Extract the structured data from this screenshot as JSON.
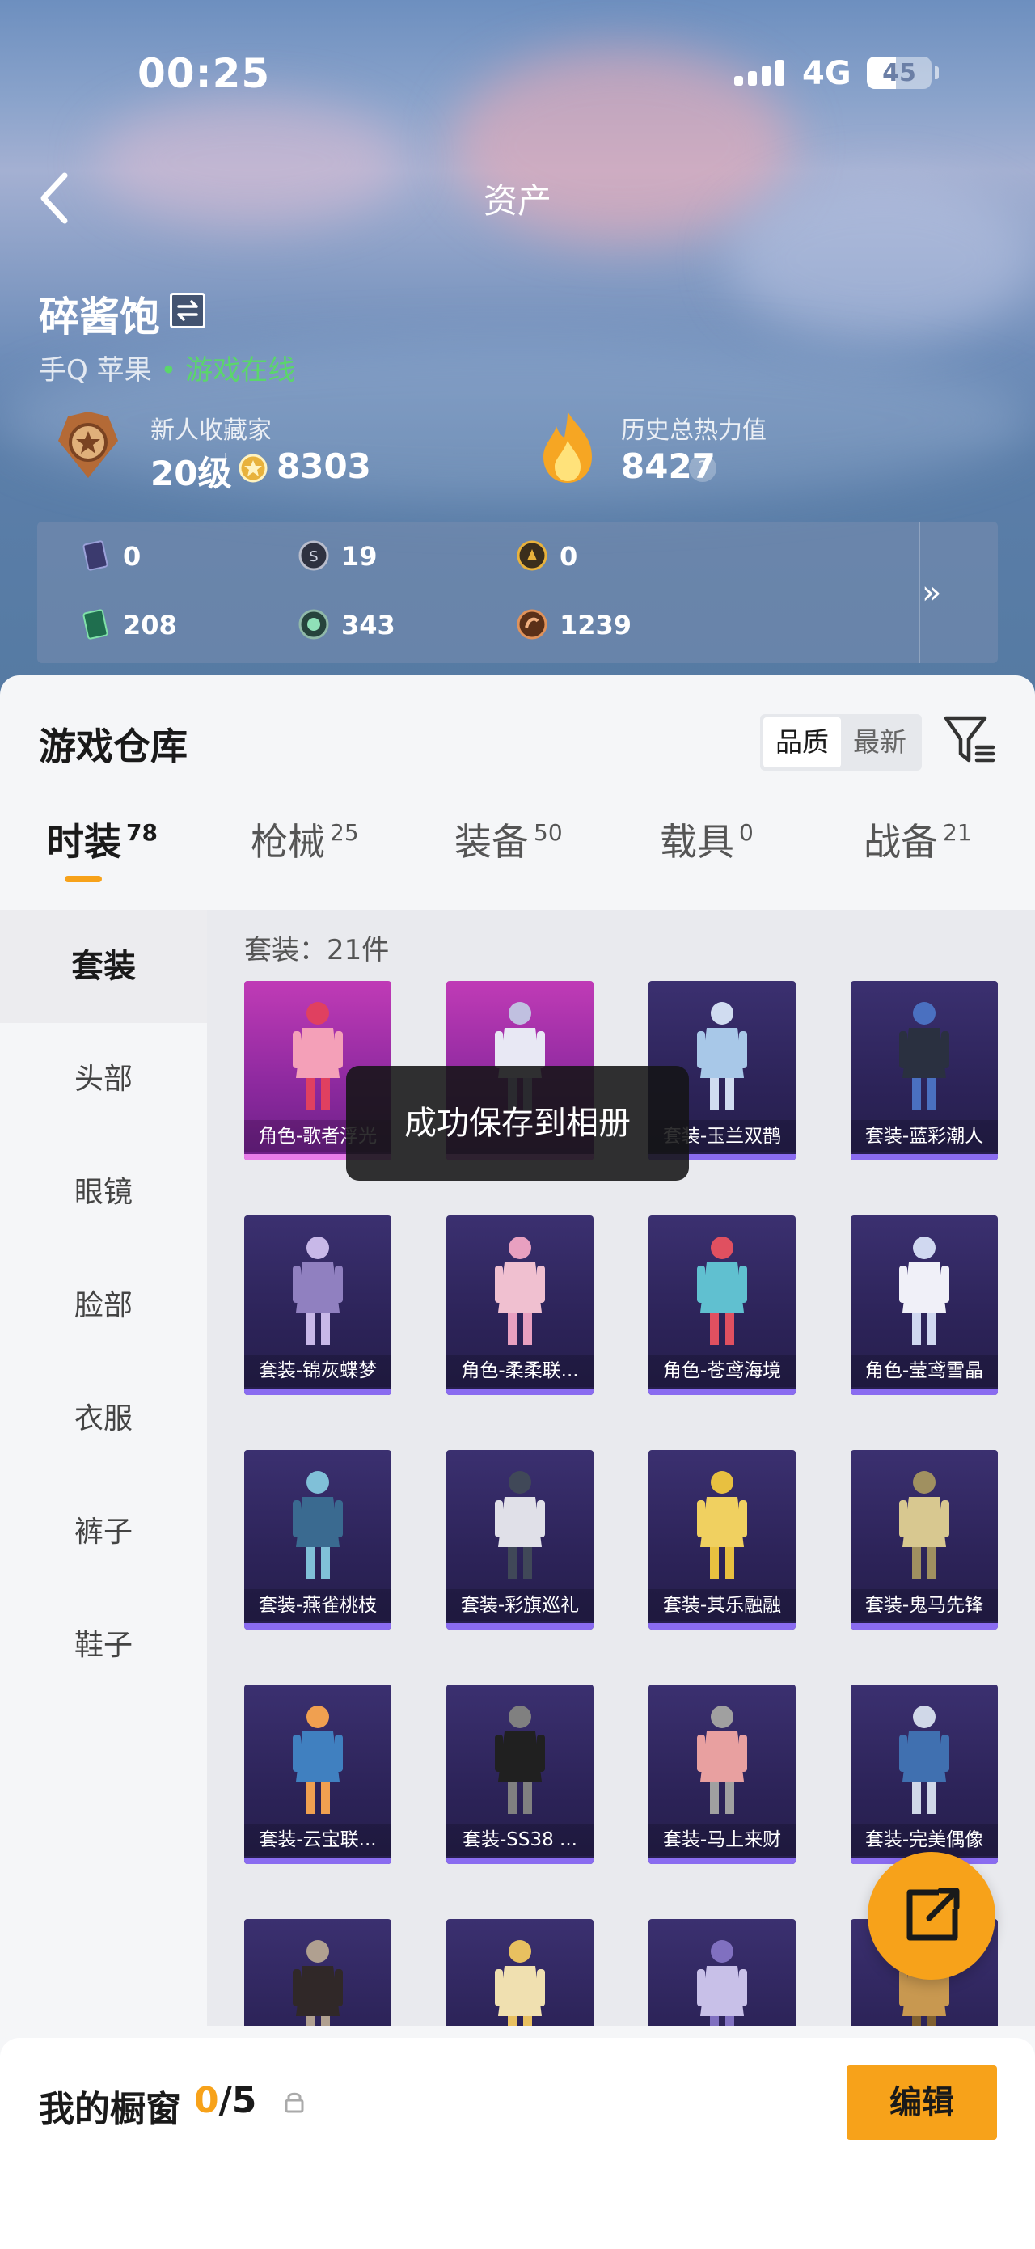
{
  "status_bar": {
    "time": "00:25",
    "network": "4G",
    "battery": "45",
    "battery_level": 0.45
  },
  "header": {
    "title": "资产"
  },
  "profile": {
    "username": "碎酱饱",
    "platform": "手Q 苹果",
    "online_status": "游戏在线",
    "collector_label": "新人收藏家",
    "level": "20级",
    "collector_points": "8303",
    "heat_label": "历史总热力值",
    "heat_value": "8427",
    "help_glyph": "?"
  },
  "currencies": [
    {
      "icon": "card-pack-icon",
      "value": "0"
    },
    {
      "icon": "silver-coin-icon",
      "value": "19"
    },
    {
      "icon": "gold-coin-icon",
      "value": "0"
    },
    {
      "icon": "voucher-ticket-icon",
      "value": "208"
    },
    {
      "icon": "green-gem-icon",
      "value": "343"
    },
    {
      "icon": "bronze-coin-icon",
      "value": "1239"
    }
  ],
  "currency_more_glyph": "»",
  "warehouse": {
    "title": "游戏仓库",
    "sort_options": [
      "品质",
      "最新"
    ],
    "tabs": [
      {
        "label": "时装",
        "count": "78"
      },
      {
        "label": "枪械",
        "count": "25"
      },
      {
        "label": "装备",
        "count": "50"
      },
      {
        "label": "载具",
        "count": "0"
      },
      {
        "label": "战备",
        "count": "21"
      }
    ],
    "categories": [
      "套装",
      "头部",
      "眼镜",
      "脸部",
      "衣服",
      "裤子",
      "鞋子"
    ],
    "section_label": "套装：21件",
    "items": [
      {
        "name": "角色-歌者浮光",
        "rarity": "pink"
      },
      {
        "name": "",
        "rarity": "pink"
      },
      {
        "name": "套装-玉兰双鹊",
        "rarity": "purple"
      },
      {
        "name": "套装-蓝彩潮人",
        "rarity": "purple"
      },
      {
        "name": "套装-锦灰蝶梦",
        "rarity": "purple"
      },
      {
        "name": "角色-柔柔联...",
        "rarity": "purple"
      },
      {
        "name": "角色-苍鸢海境",
        "rarity": "purple"
      },
      {
        "name": "角色-莹鸢雪晶",
        "rarity": "purple"
      },
      {
        "name": "套装-燕雀桃枝",
        "rarity": "purple"
      },
      {
        "name": "套装-彩旗巡礼",
        "rarity": "purple"
      },
      {
        "name": "套装-其乐融融",
        "rarity": "purple"
      },
      {
        "name": "套装-鬼马先锋",
        "rarity": "purple"
      },
      {
        "name": "套装-云宝联...",
        "rarity": "purple"
      },
      {
        "name": "套装-SS38 ...",
        "rarity": "purple"
      },
      {
        "name": "套装-马上来财",
        "rarity": "purple"
      },
      {
        "name": "套装-完美偶像",
        "rarity": "purple"
      },
      {
        "name": "",
        "rarity": "purple"
      },
      {
        "name": "",
        "rarity": "purple"
      },
      {
        "name": "",
        "rarity": "purple"
      },
      {
        "name": "",
        "rarity": "purple"
      }
    ]
  },
  "toast": "成功保存到相册",
  "showcase": {
    "title": "我的橱窗",
    "current": "0",
    "max": "/5",
    "edit_label": "编辑"
  },
  "colors": {
    "accent": "#f7a21a",
    "online": "#5bd66b",
    "card_purple": "#2c2358",
    "card_pink": "#c03bb6"
  }
}
